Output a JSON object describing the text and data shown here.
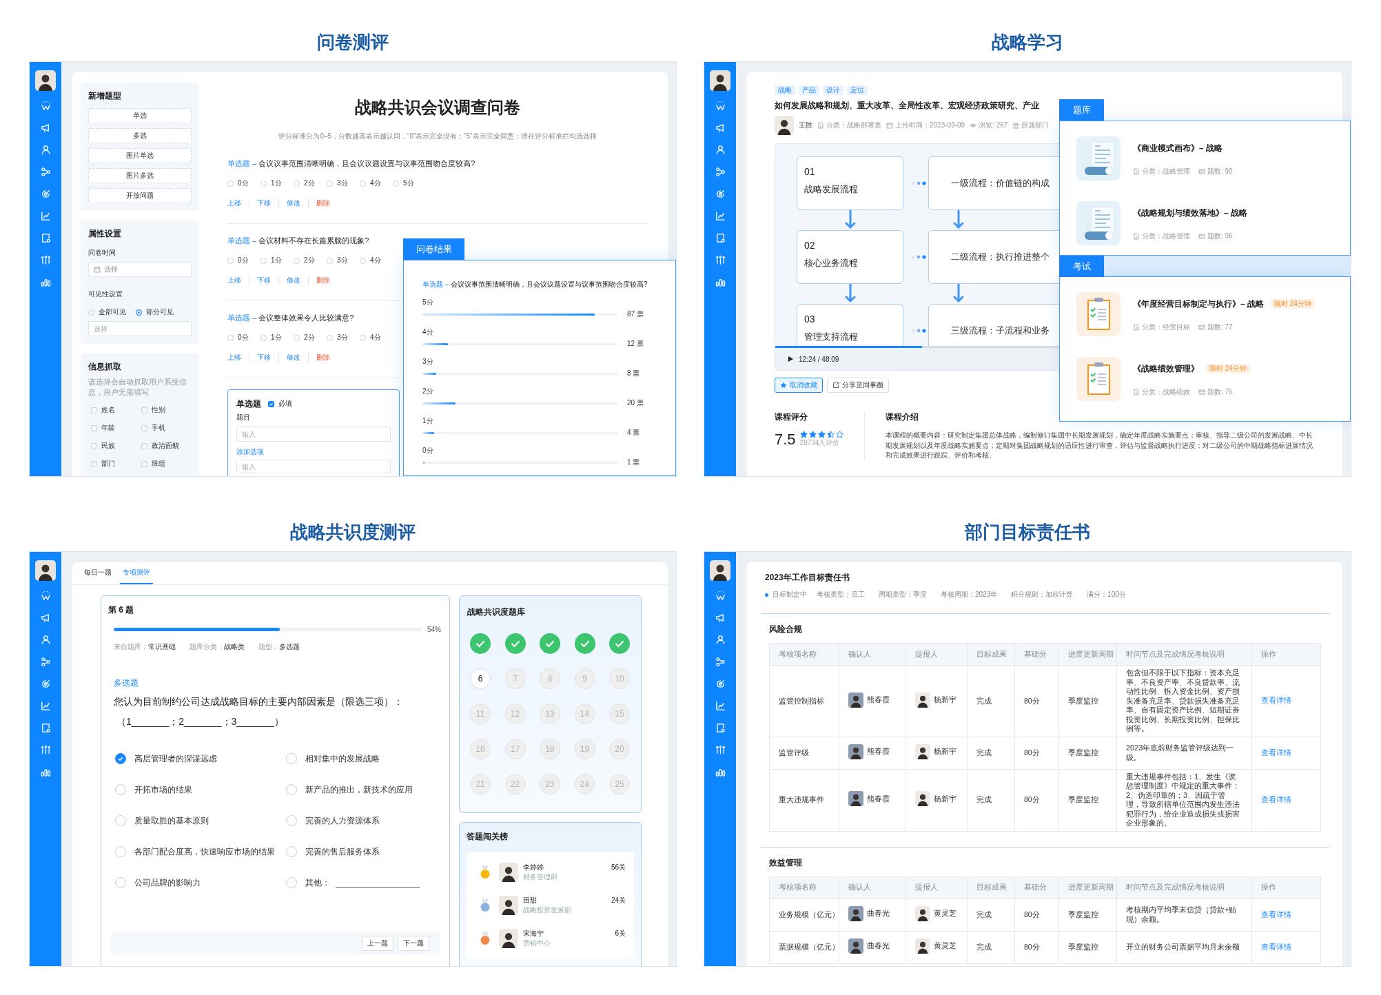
{
  "questionnaire": {
    "heading": "问卷测评",
    "add_types": {
      "title": "新增题型",
      "items": [
        "单选",
        "多选",
        "图片单选",
        "图片多选",
        "开放问题"
      ]
    },
    "attributes": {
      "title": "属性设置",
      "time_label": "问卷时间",
      "time_placeholder": "选择",
      "visibility_label": "可见性设置",
      "visibility_options": [
        {
          "label": "全部可见",
          "selected": false
        },
        {
          "label": "部分可见",
          "selected": true
        }
      ],
      "select_placeholder": "选择"
    },
    "info_capture": {
      "title": "信息抓取",
      "note": "该选择会自动抓取用户系统信息，用户无需填写",
      "fields": [
        {
          "label": "姓名",
          "checked": false
        },
        {
          "label": "性别",
          "checked": false
        },
        {
          "label": "年龄",
          "checked": false
        },
        {
          "label": "手机",
          "checked": false
        },
        {
          "label": "民族",
          "checked": false
        },
        {
          "label": "政治面貌",
          "checked": false
        },
        {
          "label": "部门",
          "checked": false
        },
        {
          "label": "班组",
          "checked": false
        }
      ]
    },
    "survey_title": "战略共识会议调查问卷",
    "instructions": "评分标准分为0–5，分数越高表示越认同，“0”表示完全没有；“5”表示完全同意；请在评分标准栏勾选选择",
    "questions": [
      {
        "type_label": "单选题 –",
        "text": "会议议事范围清晰明确，且会议议题设置与议事范围吻合度较高?",
        "options": [
          {
            "label": "0分",
            "selected": false
          },
          {
            "label": "1分",
            "selected": false
          },
          {
            "label": "2分",
            "selected": false
          },
          {
            "label": "3分",
            "selected": false
          },
          {
            "label": "4分",
            "selected": false
          },
          {
            "label": "5分",
            "selected": false
          }
        ],
        "actions": [
          {
            "label": "上移",
            "kind": "normal"
          },
          {
            "label": "下移",
            "kind": "normal"
          },
          {
            "label": "修改",
            "kind": "normal"
          },
          {
            "label": "删除",
            "kind": "danger"
          }
        ]
      },
      {
        "type_label": "单选题 –",
        "text": "会议材料不存在长篇累牍的现象?",
        "options": [
          {
            "label": "0分",
            "selected": false
          },
          {
            "label": "1分",
            "selected": false
          },
          {
            "label": "2分",
            "selected": false
          },
          {
            "label": "3分",
            "selected": false
          },
          {
            "label": "4分",
            "selected": false
          }
        ],
        "actions": [
          {
            "label": "上移",
            "kind": "normal"
          },
          {
            "label": "下移",
            "kind": "normal"
          },
          {
            "label": "修改",
            "kind": "normal"
          },
          {
            "label": "删除",
            "kind": "danger"
          }
        ]
      },
      {
        "type_label": "单选题 –",
        "text": "会议整体效果令人比较满意?",
        "options": [
          {
            "label": "0分",
            "selected": false
          },
          {
            "label": "1分",
            "selected": false
          },
          {
            "label": "2分",
            "selected": false
          },
          {
            "label": "3分",
            "selected": false
          },
          {
            "label": "4分",
            "selected": false
          }
        ],
        "actions": [
          {
            "label": "上移",
            "kind": "normal"
          },
          {
            "label": "下移",
            "kind": "normal"
          },
          {
            "label": "修改",
            "kind": "normal"
          },
          {
            "label": "删除",
            "kind": "danger"
          }
        ]
      }
    ],
    "editor": {
      "type_label": "单选题",
      "required": {
        "label": "必填",
        "checked": true
      },
      "question_label": "题目",
      "question_placeholder": "输入",
      "add_option": "添加选项",
      "option_placeholder": "输入"
    },
    "results": {
      "tab": "问卷结果",
      "type_label": "单选题 –",
      "question": "会议议事范围清晰明确，且会议议题设置与议事范围吻合度较高?",
      "rows": [
        {
          "label": "5分",
          "level": 0.88,
          "votes": "87 票"
        },
        {
          "label": "4分",
          "level": 0.13,
          "votes": "12 票"
        },
        {
          "label": "3分",
          "level": 0.07,
          "votes": "8 票"
        },
        {
          "label": "2分",
          "level": 0.17,
          "votes": "20 票"
        },
        {
          "label": "1分",
          "level": 0.06,
          "votes": "4 票"
        },
        {
          "label": "0分",
          "level": 0.01,
          "votes": "1 票"
        }
      ]
    }
  },
  "strategy_learning": {
    "heading": "战略学习",
    "tags": [
      "战略",
      "产品",
      "设计",
      "定位"
    ],
    "course_title": "如何发展战略和规划、重大改革、全局性改革、宏观经济政策研究、产业",
    "author": "王胜",
    "meta": [
      {
        "kind": "category",
        "text": "分类：战略部署类"
      },
      {
        "kind": "date",
        "text": "上传时间：2023-09-09"
      },
      {
        "kind": "views",
        "text": "浏览: 267"
      },
      {
        "kind": "department",
        "text": "所属部门"
      }
    ],
    "flow": [
      {
        "number": "01",
        "name": "战略发展流程",
        "detail": "一级流程：价值链的构成"
      },
      {
        "number": "02",
        "name": "核心业务流程",
        "detail": "二级流程：执行推进整个"
      },
      {
        "number": "03",
        "name": "管理支持流程",
        "detail": "三级流程：子流程和业务"
      }
    ],
    "video": {
      "time": "12:24 / 48:09",
      "level": 0.26
    },
    "actions": [
      {
        "label": "取消收藏",
        "kind": "favorite"
      },
      {
        "label": "分享至同事圈",
        "kind": "share"
      }
    ],
    "rating": {
      "title": "课程评分",
      "score": "7.5",
      "stars": 3.5,
      "count": "28734人评价"
    },
    "intro": {
      "title": "课程介绍",
      "text": "本课程的概要内容：研究制定集团总体战略，编制修订集团中长期发展规划，确定年度战略实施要点；审核、指导二级公司的发展战略、中长期发展规划以及年度战略实施要点；定期对集团战略规划的适应性进行审查，评估与监督战略执行进度；对二级公司的中期战略指标进展情况和完成效果进行跟踪、评价和考核。"
    },
    "library": {
      "tab": "题库",
      "items": [
        {
          "title": "《商业模式画布》– 战略",
          "category": "分类：战略管理",
          "count": "题数: 90"
        },
        {
          "title": "《战略规划与绩效落地》– 战略",
          "category": "分类：战略管理",
          "count": "题数: 96"
        }
      ]
    },
    "exams": {
      "tab": "考试",
      "items": [
        {
          "title": "《年度经营目标制定与执行》– 战略",
          "badge": "限时 24分钟",
          "category": "分类：经营目标",
          "count": "题数: 77"
        },
        {
          "title": "《战略绩效管理》",
          "badge": "限时 24分钟",
          "category": "分类：战略绩效",
          "count": "题数: 75"
        }
      ]
    }
  },
  "consensus_assessment": {
    "heading": "战略共识度测评",
    "tabs": [
      {
        "label": "每日一题",
        "selected": false
      },
      {
        "label": "专项测评",
        "selected": true
      }
    ],
    "question": {
      "number": "第 6 题",
      "progress": {
        "level": 0.54,
        "text": "54%"
      },
      "meta": [
        {
          "label": "来自题库：",
          "value": "常识基础"
        },
        {
          "label": "题库分类：",
          "value": "战略类"
        },
        {
          "label": "题型：",
          "value": "多选题"
        }
      ],
      "type": "多选题",
      "text": "您认为目前制约公司达成战略目标的主要内部因素是（限选三项）：",
      "blanks": "（1_______；2_______；3_______）",
      "options": [
        {
          "label": "高层管理者的深谋远虑",
          "kind": "choice",
          "checked": true
        },
        {
          "label": "相对集中的发展战略",
          "kind": "choice",
          "checked": false
        },
        {
          "label": "开拓市场的结果",
          "kind": "choice",
          "checked": false
        },
        {
          "label": "新产品的推出，新技术的应用",
          "kind": "choice",
          "checked": false
        },
        {
          "label": "质量取胜的基本原则",
          "kind": "choice",
          "checked": false
        },
        {
          "label": "完善的人力资源体系",
          "kind": "choice",
          "checked": false
        },
        {
          "label": "各部门配合度高，快速响应市场的结果",
          "kind": "choice",
          "checked": false
        },
        {
          "label": "完善的售后服务体系",
          "kind": "choice",
          "checked": false
        },
        {
          "label": "公司品牌的影响力",
          "kind": "choice",
          "checked": false
        },
        {
          "label": "其他：",
          "kind": "other",
          "checked": false
        }
      ],
      "nav": [
        "上一题",
        "下一题"
      ]
    },
    "bank": {
      "title": "战略共识度题库",
      "items": [
        {
          "kind": "done"
        },
        {
          "kind": "done"
        },
        {
          "kind": "done"
        },
        {
          "kind": "done"
        },
        {
          "kind": "done"
        },
        {
          "kind": "current",
          "label": "6"
        },
        {
          "kind": "todo",
          "label": "7"
        },
        {
          "kind": "todo",
          "label": "8"
        },
        {
          "kind": "todo",
          "label": "9"
        },
        {
          "kind": "todo",
          "label": "10"
        },
        {
          "kind": "todo",
          "label": "11"
        },
        {
          "kind": "todo",
          "label": "12"
        },
        {
          "kind": "todo",
          "label": "13"
        },
        {
          "kind": "todo",
          "label": "14"
        },
        {
          "kind": "todo",
          "label": "15"
        },
        {
          "kind": "todo",
          "label": "16"
        },
        {
          "kind": "todo",
          "label": "17"
        },
        {
          "kind": "todo",
          "label": "18"
        },
        {
          "kind": "todo",
          "label": "19"
        },
        {
          "kind": "todo",
          "label": "20"
        },
        {
          "kind": "todo",
          "label": "21"
        },
        {
          "kind": "todo",
          "label": "22"
        },
        {
          "kind": "todo",
          "label": "23"
        },
        {
          "kind": "todo",
          "label": "24"
        },
        {
          "kind": "todo",
          "label": "25"
        }
      ]
    },
    "leaderboard": {
      "title": "答题闯关榜",
      "entries": [
        {
          "color": "#f5b50a",
          "name": "李婷婷",
          "dept": "财务管理部",
          "score": "56关"
        },
        {
          "color": "#8fb2e6",
          "name": "田甜",
          "dept": "战略投资发展部",
          "score": "24关"
        },
        {
          "color": "#f08a4b",
          "name": "宋海宁",
          "dept": "营销中心",
          "score": "6关"
        }
      ]
    }
  },
  "department_targets": {
    "heading": "部门目标责任书",
    "title": "2023年工作目标责任书",
    "status": "目标制定中",
    "meta": [
      "考核类型：员工",
      "周期类型：季度",
      "考核周期：2023年",
      "积分规则：加权计算",
      "满分：100分"
    ],
    "sections": [
      {
        "title": "风险合规",
        "columns": [
          "考核项名称",
          "确认人",
          "提报人",
          "目标成果",
          "基础分",
          "进度更新周期",
          "时间节点及完成情况考核说明",
          "操作"
        ],
        "rows": [
          {
            "item": "监管控制指标",
            "confirmer": "熊春霞",
            "reporter": "杨新宇",
            "result": "完成",
            "base": "80分",
            "cycle": "季度监控",
            "description": "包含但不限于以下指标：资本充足率、不良资产率、不良贷款率、流动性比例、拆入资金比例、资产损失准备充足率、贷款损失准备充足率、自有固定资产比例、短期证券投资比例、长期投资比例、担保比例等。",
            "action": "查看详情"
          },
          {
            "item": "监管评级",
            "confirmer": "熊春霞",
            "reporter": "杨新宇",
            "result": "完成",
            "base": "80分",
            "cycle": "季度监控",
            "description": "2023年底前财务监管评级达到一级。",
            "action": "查看详情"
          },
          {
            "item": "重大违规事件",
            "confirmer": "熊春霞",
            "reporter": "杨新宇",
            "result": "完成",
            "base": "80分",
            "cycle": "季度监控",
            "description": "重大违规事件包括：1、发生《奖惩管理制度》中规定的重大事件；2、伪造印章的；3、因疏于管理，导致所辖单位范围内发生违法犯罪行为，给企业造成损失或损害企业形象的。",
            "action": "查看详情"
          }
        ]
      },
      {
        "title": "效益管理",
        "columns": [
          "考核项名称",
          "确认人",
          "提报人",
          "目标成果",
          "基础分",
          "进度更新周期",
          "时间节点及完成情况考核说明",
          "操作"
        ],
        "rows": [
          {
            "item": "业务规模（亿元）",
            "confirmer": "曲春光",
            "reporter": "黄灵芝",
            "result": "完成",
            "base": "80分",
            "cycle": "季度监控",
            "description": "考核期内平均季末信贷（贷款+贴现）余额。",
            "action": "查看详情"
          },
          {
            "item": "票据规模（亿元）",
            "confirmer": "曲春光",
            "reporter": "黄灵芝",
            "result": "完成",
            "base": "80分",
            "cycle": "季度监控",
            "description": "开立的财务公司票据平均月末余额",
            "action": "查看详情"
          }
        ]
      }
    ]
  }
}
